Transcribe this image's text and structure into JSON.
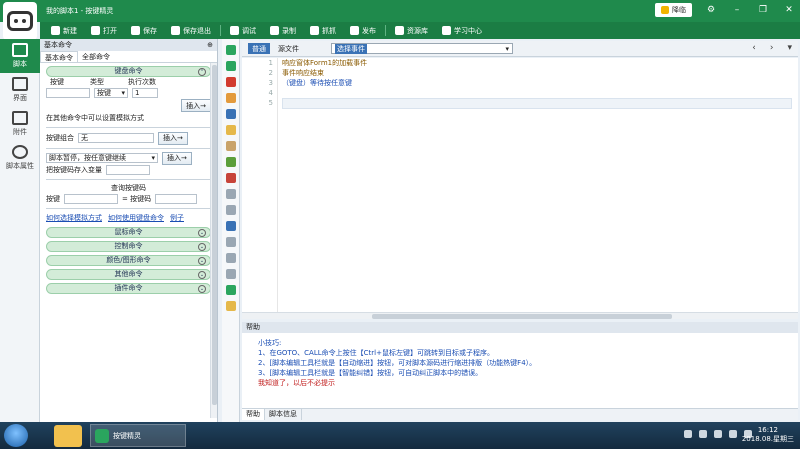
{
  "window": {
    "title": "我的脚本1 - 按键精灵",
    "vip_label": "降临"
  },
  "toolbar": {
    "items": [
      "新建",
      "打开",
      "保存",
      "保存退出",
      "调试",
      "录制",
      "抓抓",
      "发布",
      "资源库",
      "学习中心"
    ]
  },
  "rail": {
    "items": [
      "脚本",
      "界面",
      "附件",
      "脚本属性"
    ]
  },
  "panel": {
    "header": "基本命令",
    "pin": "⊕",
    "tabs": [
      "基本命令",
      "全部命令"
    ],
    "key_group": "键盘命令",
    "col_key": "按键",
    "col_type": "类型",
    "col_times": "执行次数",
    "type_value": "按键",
    "times_value": "1",
    "insert_label": "插入→",
    "bg_mode_label": "在其他命令中可以设置模拟方式",
    "combo_label": "按键组合",
    "combo_value": "无",
    "pause_label": "脚本暂停，按任意键继续",
    "save_var_label": "把按键码存入变量",
    "query_label": "查询按键码",
    "query_key_label": "按键",
    "query_code_label": "= 按键码",
    "link1": "如何选择模拟方式",
    "link2": "如何使用键盘命令",
    "link3": "例子",
    "groups": [
      "鼠标命令",
      "控制命令",
      "颜色/图形命令",
      "其他命令",
      "插件命令"
    ]
  },
  "editor": {
    "tab_normal": "普通",
    "tab_source": "源文件",
    "event_select": "选择事件",
    "lines": [
      "1",
      "2",
      "3",
      "4",
      "5"
    ],
    "code": [
      "响应窗体Form1的加载事件",
      "事件响应结束",
      "（键盘）等待按任意键"
    ]
  },
  "help": {
    "title": "帮助",
    "lines": [
      "小技巧:",
      "1、在GOTO、CALL命令上按住【Ctrl+鼠标左键】可跳转到目标或子程序。",
      "2、[脚本编辑工具栏就是【自动缩进】按钮，可对脚本源码进行缩进排版（功能热键F4）。",
      "3、[脚本编辑工具栏就是【智能纠错】按钮，可自动纠正脚本中的错误。"
    ],
    "warn": "我知道了，以后不必提示",
    "tabs": [
      "帮助",
      "脚本信息"
    ]
  },
  "taskbar": {
    "app_label": "按键精灵",
    "time": "16:12",
    "date": "2018.08.星期三"
  }
}
